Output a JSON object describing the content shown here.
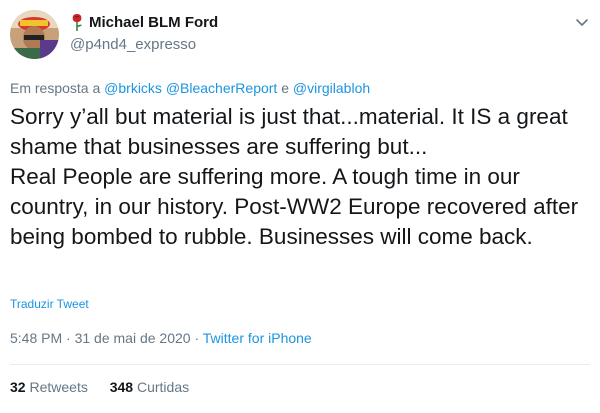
{
  "user": {
    "display_name": "Michael BLM Ford",
    "handle": "@p4nd4_expresso",
    "avatar": "avatar-photo",
    "badge_icon": "rose-icon"
  },
  "reply": {
    "prefix": "Em resposta a ",
    "mentions": [
      "@brkicks",
      "@BleacherReport"
    ],
    "conjunction": " e ",
    "last_mention": "@virgilabloh"
  },
  "tweet": {
    "text": "Sorry y’all but material is just that...material. It IS a great shame that businesses are suffering but...\nReal People are suffering more. A tough time in our country, in our history. Post-WW2 Europe recovered after being bombed to rubble. Businesses will come back.",
    "translate_label": "Traduzir Tweet"
  },
  "meta": {
    "time": "5:48 PM",
    "separator": " · ",
    "date": "31 de mai de 2020",
    "source": "Twitter for iPhone"
  },
  "stats": {
    "retweets_count": "32",
    "retweets_label": "Retweets",
    "likes_count": "348",
    "likes_label": "Curtidas"
  },
  "colors": {
    "link": "#1b95e0",
    "secondary": "#657786",
    "primary": "#14171a"
  }
}
